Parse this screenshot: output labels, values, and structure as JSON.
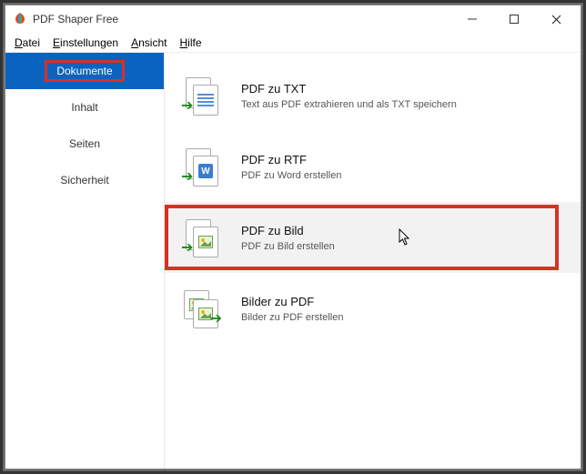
{
  "window": {
    "title": "PDF Shaper Free"
  },
  "menu": {
    "file": "Datei",
    "settings": "Einstellungen",
    "view": "Ansicht",
    "help": "Hilfe"
  },
  "sidebar": {
    "items": [
      {
        "label": "Dokumente"
      },
      {
        "label": "Inhalt"
      },
      {
        "label": "Seiten"
      },
      {
        "label": "Sicherheit"
      }
    ]
  },
  "items": [
    {
      "title": "PDF zu TXT",
      "desc": "Text aus PDF extrahieren und als TXT speichern"
    },
    {
      "title": "PDF zu RTF",
      "desc": "PDF zu Word erstellen"
    },
    {
      "title": "PDF zu Bild",
      "desc": "PDF zu Bild erstellen"
    },
    {
      "title": "Bilder zu PDF",
      "desc": "Bilder zu PDF erstellen"
    }
  ]
}
